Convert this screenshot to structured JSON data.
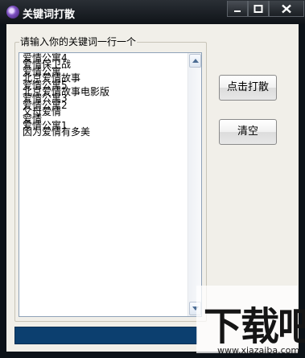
{
  "window": {
    "title": "关键词打散",
    "icon": "app-icon"
  },
  "input_group": {
    "label": "请输入你的关键词一行一个",
    "lines": [
      "爱情公寓4",
      "爱情保卫战",
      "爱情公寓",
      "北京爱情故事",
      "爱情公寓5",
      "北京爱情故事电影版",
      "爱情公寓3",
      "爱情公寓2",
      "父母爱情",
      "爱情",
      "爱情公寓1",
      "因为爱情有多美"
    ]
  },
  "buttons": {
    "scatter_label": "点击打散",
    "clear_label": "清空"
  },
  "progress": {
    "value_fraction": 1.0,
    "color": "#0c3f6f"
  },
  "watermark": {
    "text": "下载吧",
    "url": "www.xiazaiba.com"
  },
  "colors": {
    "titlebar": "#0f1318",
    "client_bg": "#f1efe9",
    "progress_fill": "#0c3f6f"
  }
}
